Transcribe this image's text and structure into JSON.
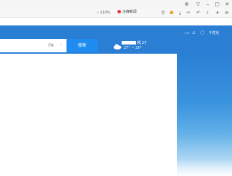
{
  "window": {
    "controls": [
      "⊕",
      "▽",
      "–",
      "□",
      "✕"
    ]
  },
  "toolbar": {
    "zoom_label": "⌕ 110%",
    "search_text": "汪峰新闻",
    "icons": [
      "search-icon",
      "game-icon",
      "download-icon",
      "cut-icon",
      "undo-icon",
      "night-icon",
      "add-icon",
      "menu-icon"
    ]
  },
  "search": {
    "engine": "百度",
    "button_label": "搜索",
    "input_value": ""
  },
  "weather": {
    "temp_now": "晴 27",
    "range": "27° ~ 28°"
  },
  "header": {
    "personalize_label": "个性化"
  },
  "colors": {
    "header_blue": "#2a7fd4",
    "button_blue": "#1e8cf0"
  }
}
